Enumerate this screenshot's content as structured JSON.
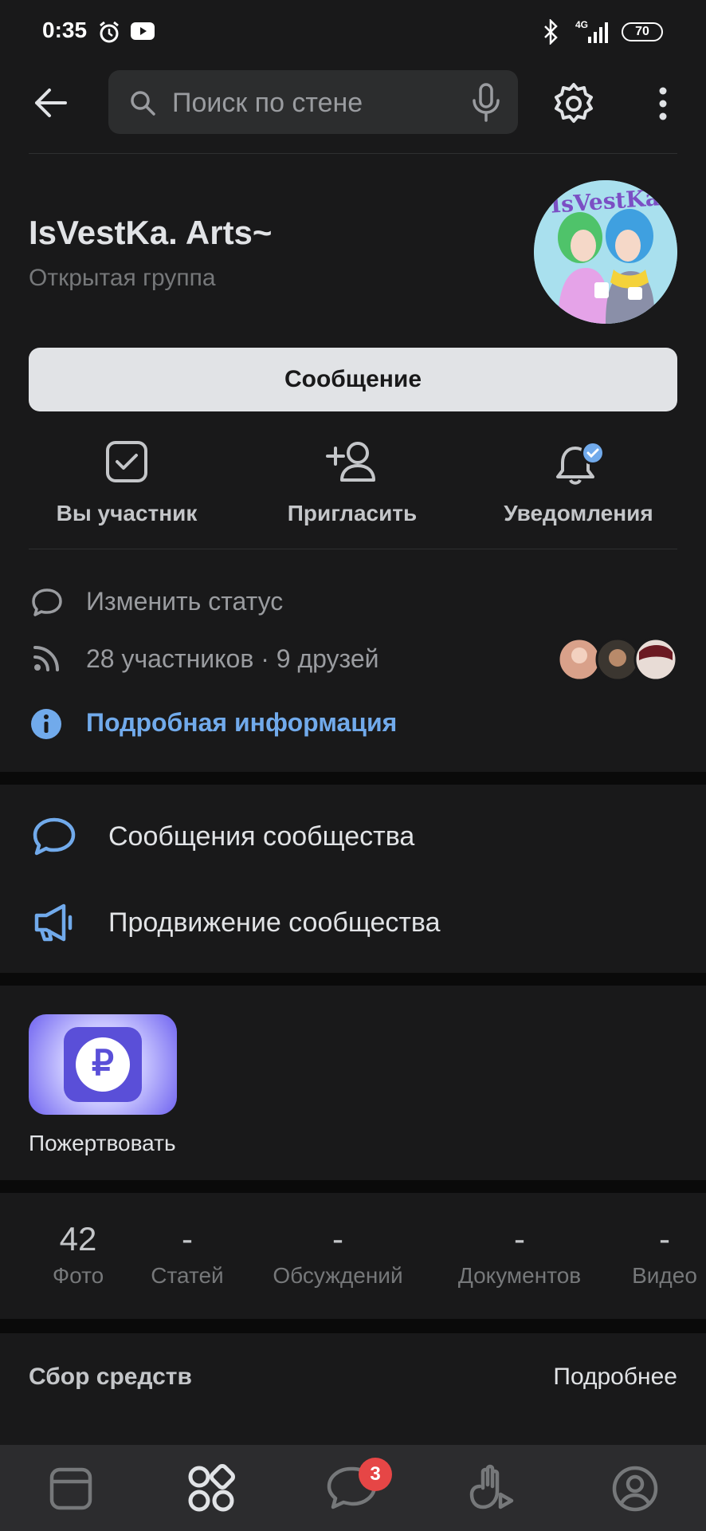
{
  "status_bar": {
    "time": "0:35",
    "network": "4G",
    "battery": "70"
  },
  "search": {
    "placeholder": "Поиск по стене"
  },
  "group": {
    "name": "IsVestKa. Arts~",
    "type": "Открытая группа",
    "avatar_text": "IsVestKa"
  },
  "message_button": "Сообщение",
  "actions": [
    {
      "label": "Вы участник",
      "icon": "checkbox-icon"
    },
    {
      "label": "Пригласить",
      "icon": "add-user-icon"
    },
    {
      "label": "Уведомления",
      "icon": "bell-icon"
    }
  ],
  "info": {
    "status": "Изменить статус",
    "members": "28 участников · 9 друзей",
    "details": "Подробная информация"
  },
  "menu": {
    "messages": "Сообщения сообщества",
    "promotion": "Продвижение сообщества"
  },
  "donate": {
    "label": "Пожертвовать",
    "symbol": "₽"
  },
  "counters": [
    {
      "value": "42",
      "label": "Фото"
    },
    {
      "value": "-",
      "label": "Статей"
    },
    {
      "value": "-",
      "label": "Обсуждений"
    },
    {
      "value": "-",
      "label": "Документов"
    },
    {
      "value": "-",
      "label": "Видео"
    }
  ],
  "fundraising": {
    "title": "Сбор средств",
    "more": "Подробнее"
  },
  "tabbar": {
    "messages_badge": "3"
  },
  "colors": {
    "accent": "#71aaeb",
    "background": "#19191a",
    "badge": "#e64646"
  }
}
